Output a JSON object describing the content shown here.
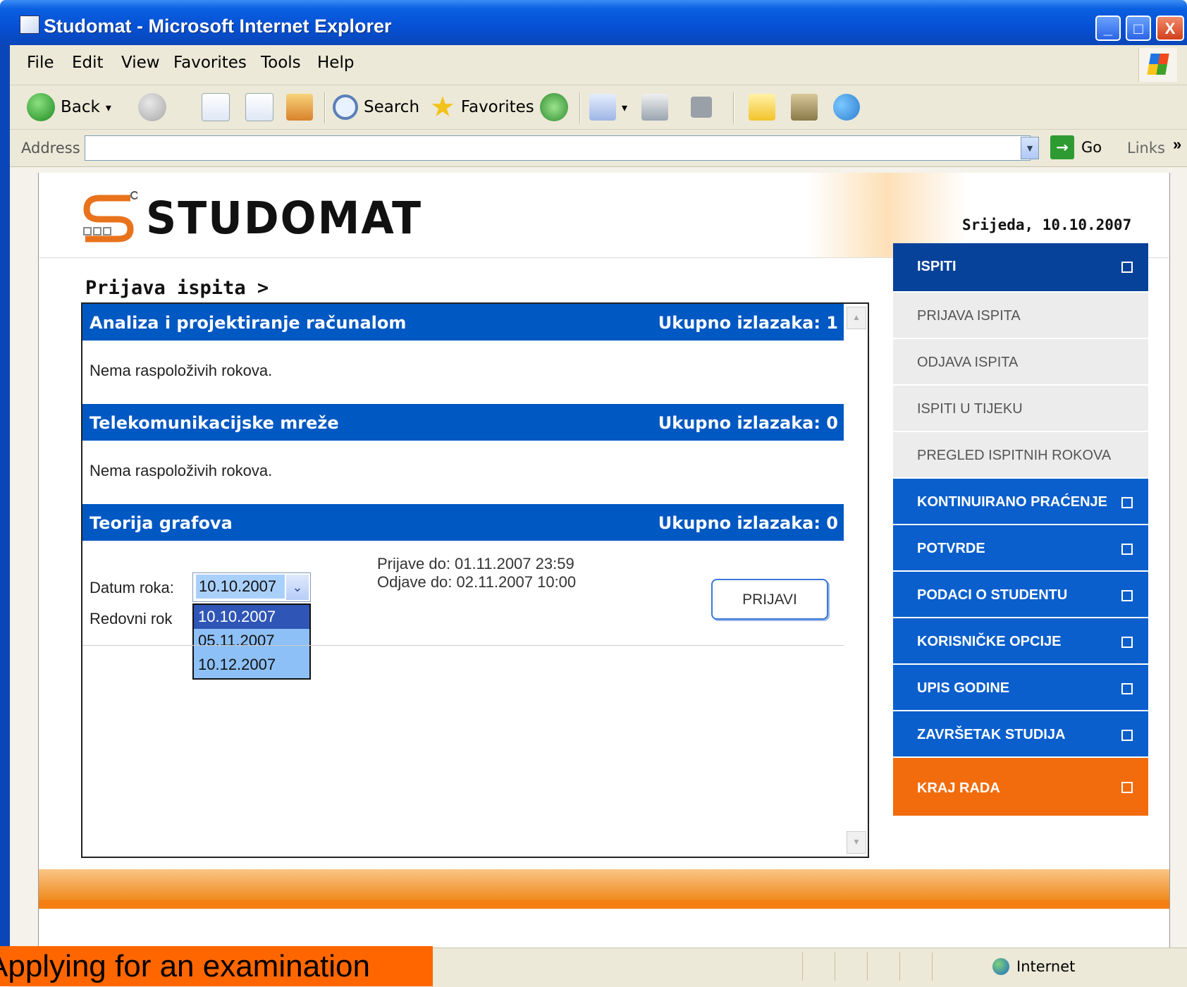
{
  "window": {
    "title": "Studomat - Microsoft Internet Explorer",
    "controls": {
      "minimize": "_",
      "maximize": "□",
      "close": "X"
    }
  },
  "menubar": [
    "File",
    "Edit",
    "View",
    "Favorites",
    "Tools",
    "Help"
  ],
  "toolbar": {
    "back_label": "Back",
    "search_label": "Search",
    "favorites_label": "Favorites",
    "dropdown_glyph": "▾"
  },
  "addressbar": {
    "label": "Address",
    "value": "",
    "go_label": "Go",
    "links_label": "Links",
    "links_chevron": "»"
  },
  "site": {
    "logo_text": "STUDOMAT",
    "date": "Srijeda, 10.10.2007",
    "breadcrumb": "Prijava ispita >"
  },
  "courses": [
    {
      "name": "Analiza i projektiranje računalom",
      "count": "Ukupno izlazaka: 1",
      "message": "Nema raspoloživih rokova."
    },
    {
      "name": "Telekomunikacijske mreže",
      "count": "Ukupno izlazaka: 0",
      "message": "Nema raspoloživih rokova."
    },
    {
      "name": "Teorija grafova",
      "count": "Ukupno izlazaka: 0"
    }
  ],
  "exam_form": {
    "date_label": "Datum roka:",
    "selected_date": "10.10.2007",
    "term_type": "Redovni rok",
    "options": [
      "10.10.2007",
      "05.11.2007",
      "10.12.2007"
    ],
    "register_until": "Prijave do: 01.11.2007 23:59",
    "unregister_until": "Odjave do: 02.11.2007 10:00",
    "submit_label": "PRIJAVI"
  },
  "sidebar": {
    "section": "ISPITI",
    "sub_items": [
      "PRIJAVA ISPITA",
      "ODJAVA ISPITA",
      "ISPITI U TIJEKU",
      "PREGLED ISPITNIH ROKOVA"
    ],
    "items": [
      "KONTINUIRANO PRAĆENJE",
      "POTVRDE",
      "PODACI O STUDENTU",
      "KORISNIČKE OPCIJE",
      "UPIS GODINE",
      "ZAVRŠETAK STUDIJA"
    ],
    "logout": "KRAJ RADA"
  },
  "statusbar": {
    "zone": "Internet"
  },
  "caption": "Applying for an examination",
  "colors": {
    "header_blue": "#0058c2",
    "sidebar_blue": "#0a5fcc",
    "orange": "#f26b0c",
    "xp_title": "#0650d4"
  }
}
